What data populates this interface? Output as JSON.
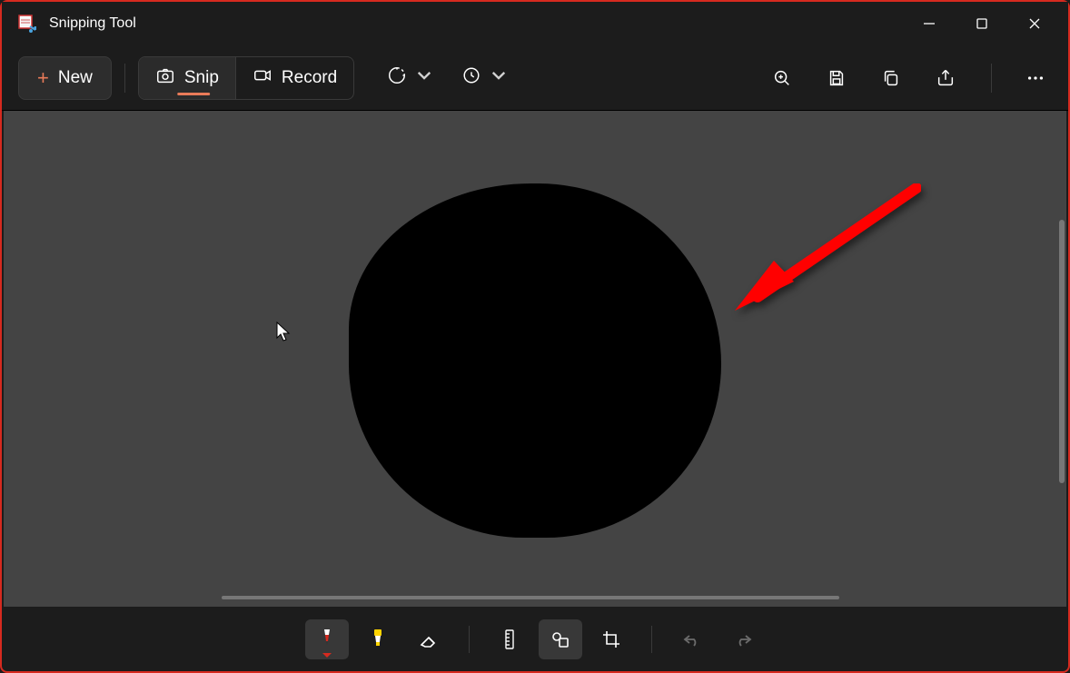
{
  "titlebar": {
    "title": "Snipping Tool"
  },
  "toolbar": {
    "new_label": "New",
    "snip_label": "Snip",
    "record_label": "Record"
  },
  "icons": {
    "plus": "+",
    "camera": "camera",
    "video": "video",
    "mode": "mode",
    "delay": "delay",
    "zoom": "zoom",
    "save": "save",
    "copy": "copy",
    "share": "share",
    "more": "more",
    "pen": "pen",
    "highlighter": "highlighter",
    "eraser": "eraser",
    "ruler": "ruler",
    "shapes": "shapes",
    "crop": "crop",
    "undo": "undo",
    "redo": "redo"
  },
  "colors": {
    "accent": "#e97b59",
    "annotation_arrow": "#ff0000",
    "pen_color": "#d62a1f"
  }
}
